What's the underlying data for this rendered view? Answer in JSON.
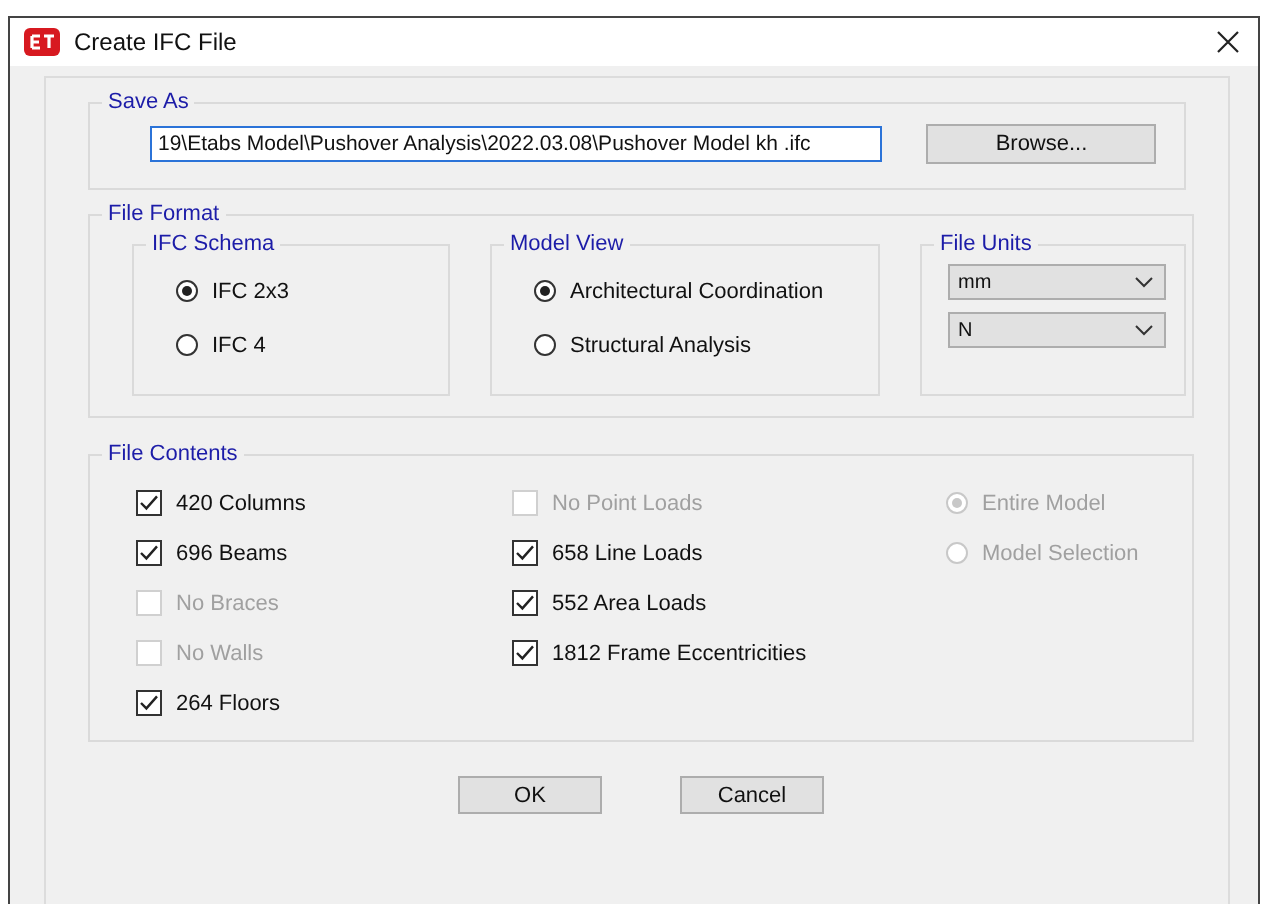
{
  "window": {
    "title": "Create IFC File"
  },
  "save_as": {
    "label": "Save As",
    "path": "19\\Etabs Model\\Pushover Analysis\\2022.03.08\\Pushover Model kh .ifc",
    "browse": "Browse..."
  },
  "file_format": {
    "label": "File Format",
    "schema": {
      "label": "IFC Schema",
      "options": [
        {
          "label": "IFC 2x3",
          "selected": true
        },
        {
          "label": "IFC 4",
          "selected": false
        }
      ]
    },
    "model_view": {
      "label": "Model View",
      "options": [
        {
          "label": "Architectural Coordination",
          "selected": true
        },
        {
          "label": "Structural Analysis",
          "selected": false
        }
      ]
    },
    "units": {
      "label": "File Units",
      "fields": [
        {
          "value": "mm"
        },
        {
          "value": "N"
        }
      ]
    }
  },
  "file_contents": {
    "label": "File Contents",
    "columns": [
      [
        {
          "label": "420 Columns",
          "checked": true,
          "disabled": false
        },
        {
          "label": "696 Beams",
          "checked": true,
          "disabled": false
        },
        {
          "label": "No Braces",
          "checked": false,
          "disabled": true
        },
        {
          "label": "No Walls",
          "checked": false,
          "disabled": true
        },
        {
          "label": "264 Floors",
          "checked": true,
          "disabled": false
        }
      ],
      [
        {
          "label": "No Point Loads",
          "checked": false,
          "disabled": true
        },
        {
          "label": "658 Line Loads",
          "checked": true,
          "disabled": false
        },
        {
          "label": "552 Area Loads",
          "checked": true,
          "disabled": false
        },
        {
          "label": "1812 Frame Eccentricities",
          "checked": true,
          "disabled": false
        }
      ]
    ],
    "scope": {
      "disabled": true,
      "options": [
        {
          "label": "Entire Model",
          "selected": true
        },
        {
          "label": "Model Selection",
          "selected": false
        }
      ]
    }
  },
  "buttons": [
    "OK",
    "Cancel"
  ]
}
